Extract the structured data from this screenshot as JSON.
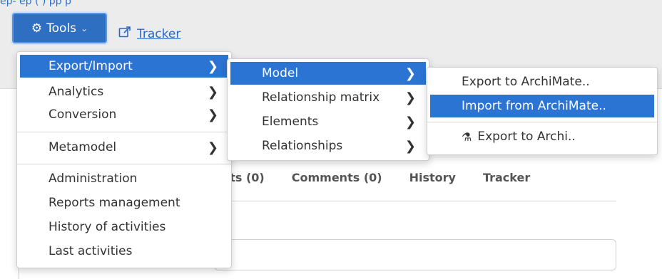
{
  "top_link_text": "ep-                   ep                            (                        )                   pp p",
  "tools": {
    "label": "Tools"
  },
  "tracker_link": {
    "label": "Tracker"
  },
  "tabs": [
    "ents (0)",
    "Comments (0)",
    "History",
    "Tracker"
  ],
  "menu_level1": {
    "items": [
      {
        "label": "Export/Import",
        "submenu": true
      },
      {
        "label": "Analytics",
        "submenu": true
      },
      {
        "label": "Conversion",
        "submenu": true
      },
      {
        "label": "Metamodel",
        "submenu": true
      },
      {
        "label": "Administration",
        "submenu": false
      },
      {
        "label": "Reports management",
        "submenu": false
      },
      {
        "label": "History of activities",
        "submenu": false
      },
      {
        "label": "Last activities",
        "submenu": false
      }
    ]
  },
  "menu_level2": {
    "items": [
      {
        "label": "Model",
        "submenu": true
      },
      {
        "label": "Relationship matrix",
        "submenu": true
      },
      {
        "label": "Elements",
        "submenu": true
      },
      {
        "label": "Relationships",
        "submenu": true
      }
    ]
  },
  "menu_level3": {
    "items": [
      {
        "label": "Export to ArchiMate.."
      },
      {
        "label": "Import from ArchiMate.."
      },
      {
        "label": "Export to Archi..",
        "icon": "flask-icon"
      }
    ]
  },
  "colors": {
    "accent": "#2b74d4",
    "button": "#2f6fc1",
    "link": "#2a66c9"
  }
}
